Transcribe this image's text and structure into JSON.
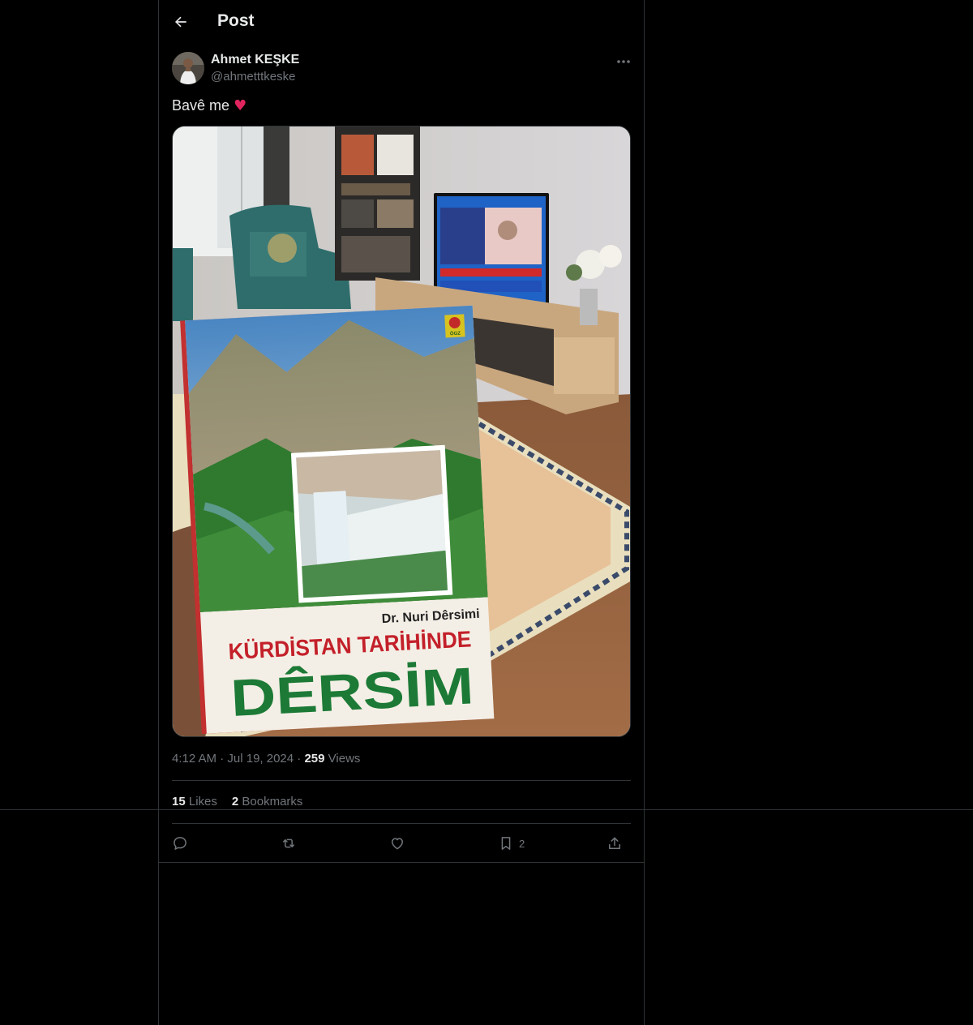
{
  "header": {
    "title": "Post"
  },
  "author": {
    "name": "Ahmet KEŞKE",
    "handle": "@ahmetttkeske"
  },
  "post": {
    "text": "Bavê me",
    "emoji": "♥",
    "book": {
      "author": "Dr. Nuri Dêrsimi",
      "title_line1": "KÜRDİSTAN TARİHİNDE",
      "title_line2": "DÊRSİM",
      "publisher": "ÖGZ"
    }
  },
  "meta": {
    "time": "4:12 AM",
    "dot": "·",
    "date": "Jul 19, 2024",
    "views_count": "259",
    "views_label": "Views"
  },
  "stats": {
    "likes_count": "15",
    "likes_label": "Likes",
    "bookmarks_count": "2",
    "bookmarks_label": "Bookmarks"
  },
  "actions": {
    "bookmark_count": "2"
  },
  "icons": [
    "back-arrow-icon",
    "more-icon",
    "reply-icon",
    "repost-icon",
    "like-icon",
    "bookmark-icon",
    "share-icon"
  ],
  "colors": {
    "background": "#000000",
    "text": "#e7e9ea",
    "muted": "#71767b",
    "border": "#2f3336",
    "heart": "#e0245e"
  }
}
